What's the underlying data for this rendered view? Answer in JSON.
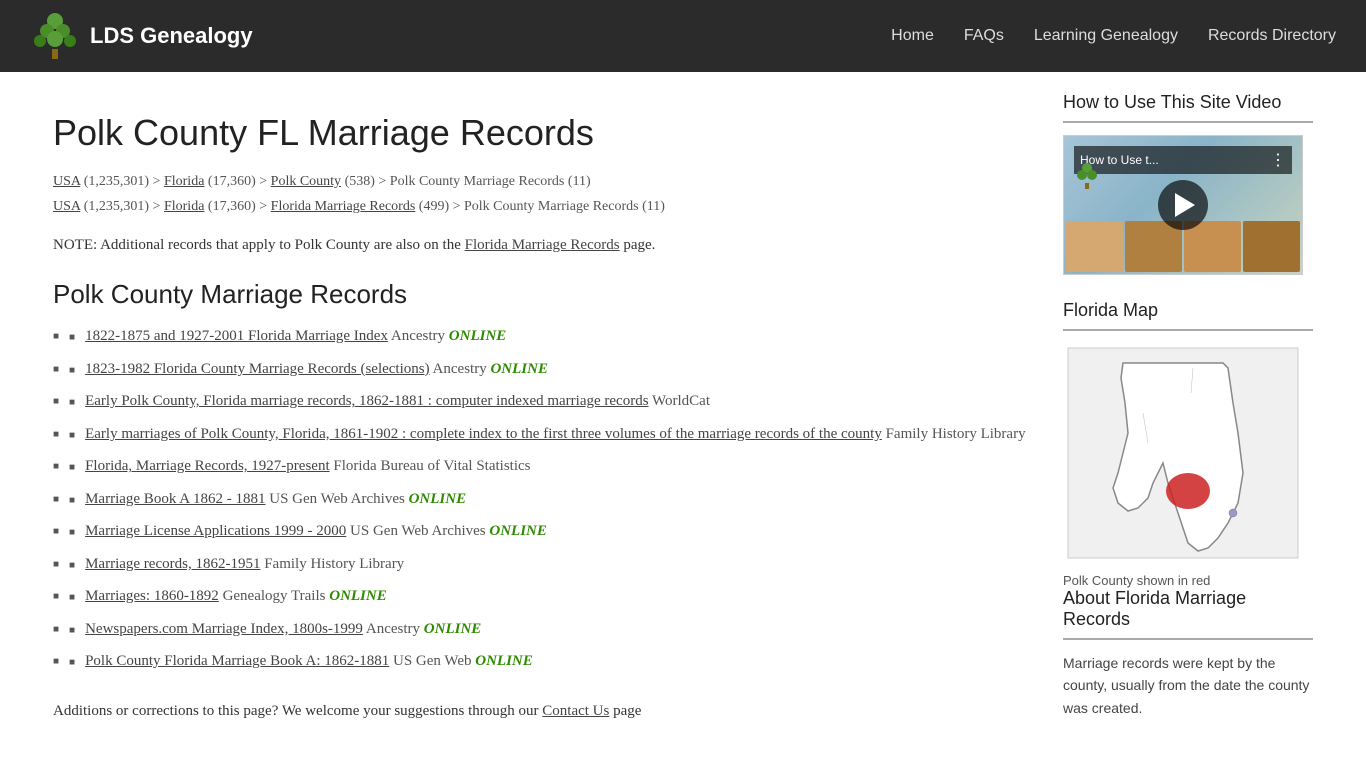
{
  "header": {
    "logo_text": "LDS Genealogy",
    "nav_links": [
      {
        "label": "Home",
        "href": "#"
      },
      {
        "label": "FAQs",
        "href": "#"
      },
      {
        "label": "Learning Genealogy",
        "href": "#"
      },
      {
        "label": "Records Directory",
        "href": "#"
      }
    ]
  },
  "main": {
    "page_title": "Polk County FL Marriage Records",
    "breadcrumb_line1": {
      "usa_label": "USA",
      "usa_count": "(1,235,301)",
      "florida_label": "Florida",
      "florida_count": "(17,360)",
      "polk_label": "Polk County",
      "polk_count": "(538)",
      "end_text": "> Polk County Marriage Records (11)"
    },
    "breadcrumb_line2": {
      "usa_label": "USA",
      "usa_count": "(1,235,301)",
      "florida_label": "Florida",
      "florida_count": "(17,360)",
      "florida_marriage_label": "Florida Marriage Records",
      "florida_marriage_count": "(499)",
      "end_text": "> Polk County Marriage Records (11)"
    },
    "note_text": "NOTE: Additional records that apply to Polk County are also on the",
    "note_link_text": "Florida Marriage Records",
    "note_end": "page.",
    "section_title": "Polk County Marriage Records",
    "records": [
      {
        "link_text": "1822-1875 and 1927-2001 Florida Marriage Index",
        "provider": "Ancestry",
        "online": true
      },
      {
        "link_text": "1823-1982 Florida County Marriage Records (selections)",
        "provider": "Ancestry",
        "online": true
      },
      {
        "link_text": "Early Polk County, Florida marriage records, 1862-1881 : computer indexed marriage records",
        "provider": "WorldCat",
        "online": false
      },
      {
        "link_text": "Early marriages of Polk County, Florida, 1861-1902 : complete index to the first three volumes of the marriage records of the county",
        "provider": "Family History Library",
        "online": false
      },
      {
        "link_text": "Florida, Marriage Records, 1927-present",
        "provider": "Florida Bureau of Vital Statistics",
        "online": false
      },
      {
        "link_text": "Marriage Book A 1862 - 1881",
        "provider": "US Gen Web Archives",
        "online": true
      },
      {
        "link_text": "Marriage License Applications 1999 - 2000",
        "provider": "US Gen Web Archives",
        "online": true
      },
      {
        "link_text": "Marriage records, 1862-1951",
        "provider": "Family History Library",
        "online": false
      },
      {
        "link_text": "Marriages: 1860-1892",
        "provider": "Genealogy Trails",
        "online": true
      },
      {
        "link_text": "Newspapers.com Marriage Index, 1800s-1999",
        "provider": "Ancestry",
        "online": true
      },
      {
        "link_text": "Polk County Florida Marriage Book A: 1862-1881",
        "provider": "US Gen Web",
        "online": true
      }
    ],
    "online_label": "ONLINE",
    "additions_text": "Additions or corrections to this page? We welcome your suggestions through our",
    "contact_link_text": "Contact Us",
    "additions_end": "page"
  },
  "sidebar": {
    "video_section_title": "How to Use This Site Video",
    "video_title_text": "How to Use t...",
    "map_section_title": "Florida Map",
    "map_caption": "Polk County shown in red",
    "about_section_title": "About Florida Marriage Records",
    "about_text": "Marriage records were kept by the county, usually from the date the county was created."
  }
}
